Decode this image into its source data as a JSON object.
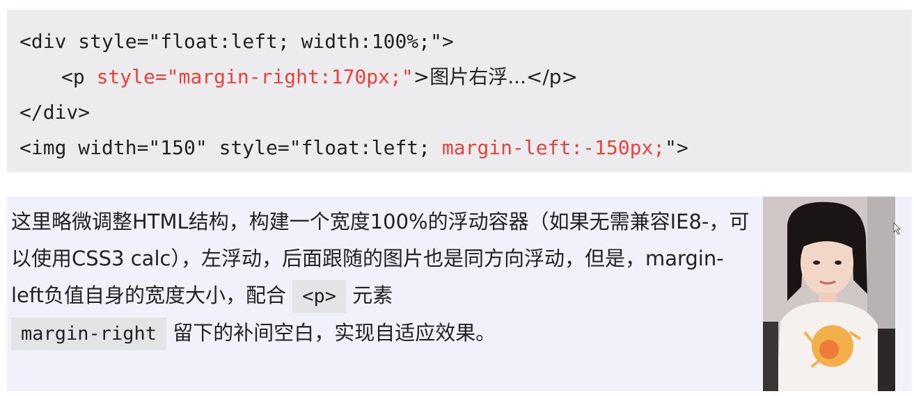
{
  "code": {
    "line1": "<div style=\"float:left; width:100%;\">",
    "line2_prefix": "<p ",
    "line2_highlight": "style=\"margin-right:170px;\"",
    "line2_suffix": ">图片右浮...</p>",
    "line3": "</div>",
    "line4_prefix": "<img width=\"150\" style=\"float:left; ",
    "line4_highlight": "margin-left:-150px;",
    "line4_suffix": "\">"
  },
  "demo": {
    "text_part1": "这里略微调整HTML结构，构建一个宽度100%的浮动容器（如果无需兼容IE8-，可以使用CSS3 calc），左浮动，后面跟随的图片也是同方向浮动，但是，margin-left负值自身的宽度大小，配合",
    "inline_code_p": "<p>",
    "text_part2": "元素",
    "inline_code_margin": "margin-right",
    "text_part3": "留下的补间空白，实现自适应效果。",
    "image_icon": "portrait-photo"
  },
  "colors": {
    "highlight": "#e8413c",
    "code_background": "#ececee",
    "demo_background": "#f0f1fa"
  }
}
